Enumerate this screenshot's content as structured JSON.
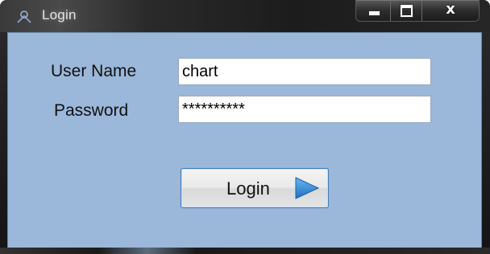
{
  "window": {
    "title": "Login"
  },
  "controls": {
    "minimize_icon": "minimize-icon",
    "maximize_icon": "maximize-icon",
    "close_glyph": "x"
  },
  "form": {
    "username_label": "User Name",
    "username_value": "chart",
    "password_label": "Password",
    "password_value": "**********",
    "login_label": "Login",
    "login_icon": "play-arrow-icon"
  },
  "colors": {
    "client_background": "#9bb7d9",
    "button_border": "#3d7bbd",
    "play_icon": "#2f86d8"
  }
}
